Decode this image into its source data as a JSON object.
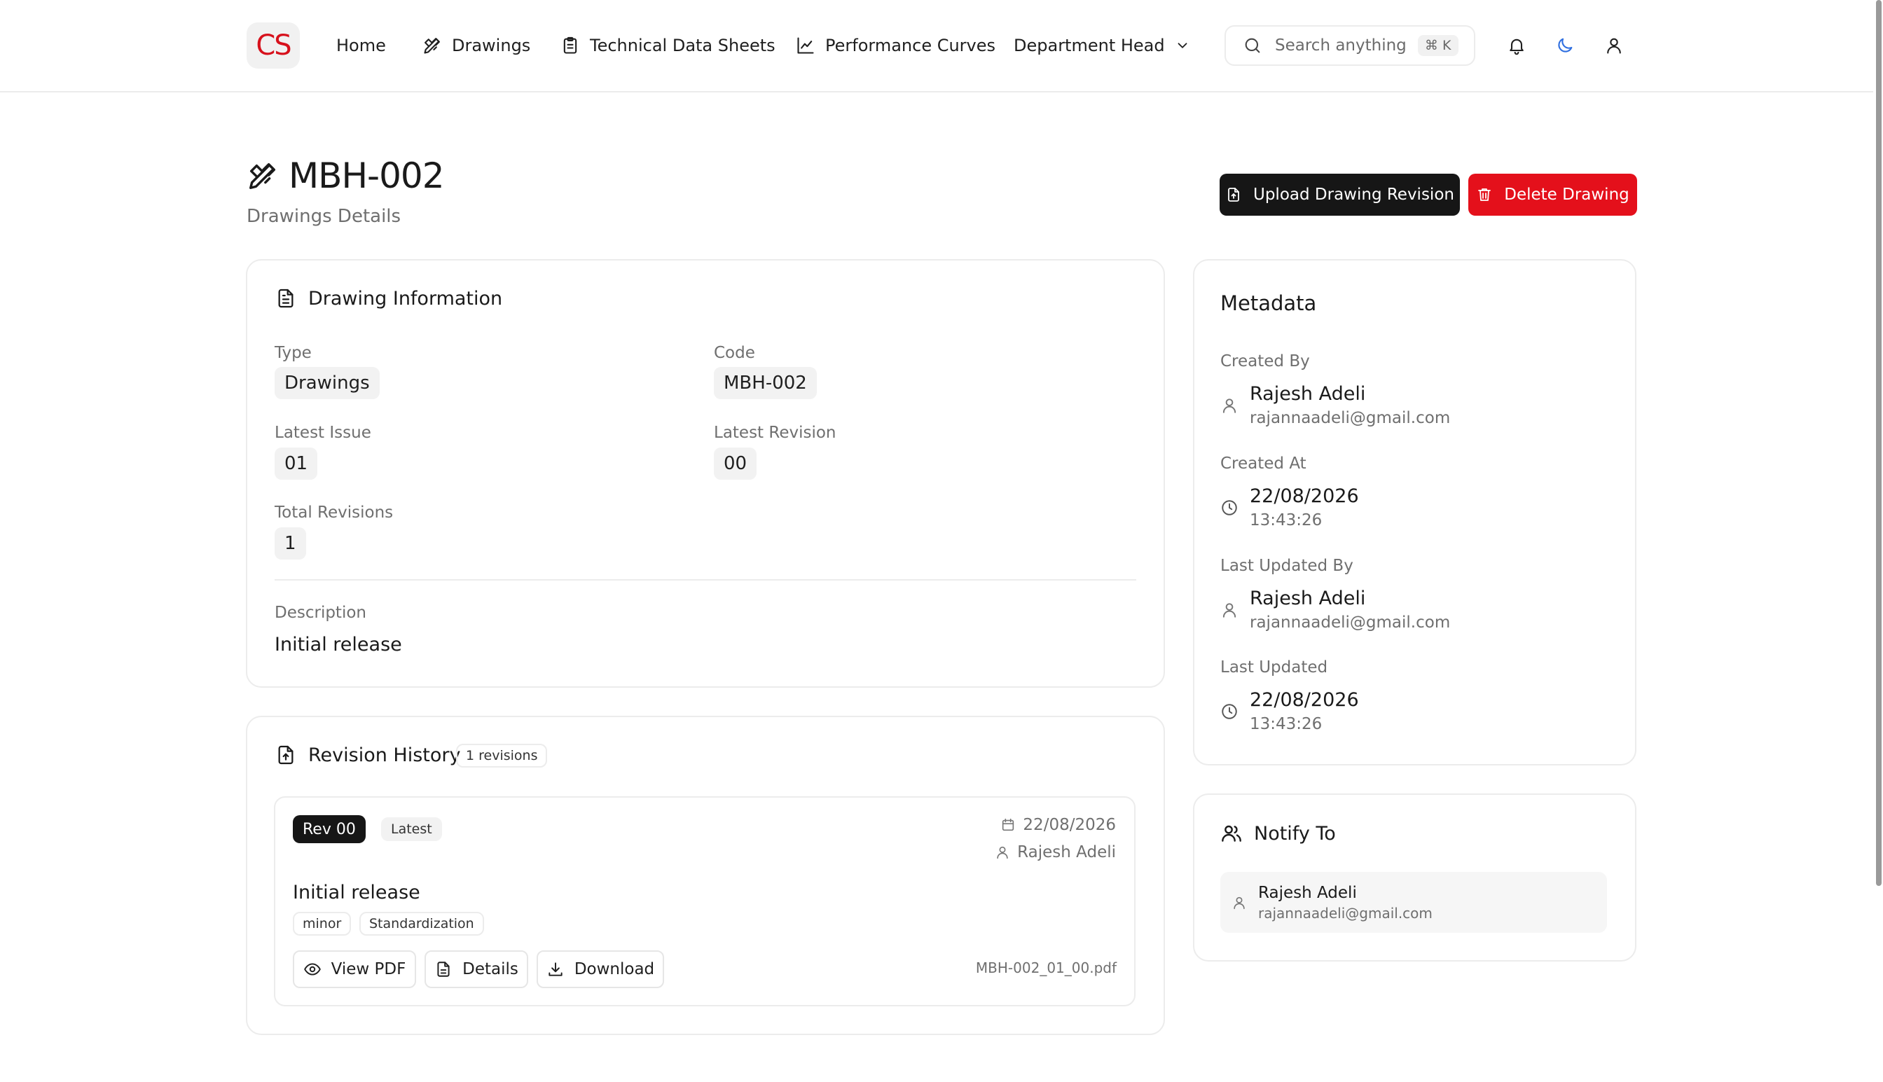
{
  "app": {
    "logo_text": "CS"
  },
  "nav": {
    "home": "Home",
    "drawings": "Drawings",
    "tds": "Technical Data Sheets",
    "curves": "Performance Curves",
    "department": "Department Head"
  },
  "search": {
    "placeholder": "Search anything...",
    "shortcut": "⌘ K"
  },
  "page": {
    "title": "MBH-002",
    "subtitle": "Drawings Details",
    "upload_label": "Upload Drawing Revision",
    "delete_label": "Delete Drawing"
  },
  "info": {
    "heading": "Drawing Information",
    "type_label": "Type",
    "type_value": "Drawings",
    "code_label": "Code",
    "code_value": "MBH-002",
    "issue_label": "Latest Issue",
    "issue_value": "01",
    "revision_label": "Latest Revision",
    "revision_value": "00",
    "total_label": "Total Revisions",
    "total_value": "1",
    "description_label": "Description",
    "description_value": "Initial release"
  },
  "metadata": {
    "heading": "Metadata",
    "created_by_label": "Created By",
    "created_by_name": "Rajesh Adeli",
    "created_by_email": "rajannaadeli@gmail.com",
    "created_at_label": "Created At",
    "created_at_date": "22/08/2026",
    "created_at_time": "13:43:26",
    "updated_by_label": "Last Updated By",
    "updated_by_name": "Rajesh Adeli",
    "updated_by_email": "rajannaadeli@gmail.com",
    "updated_label": "Last Updated",
    "updated_date": "22/08/2026",
    "updated_time": "13:43:26"
  },
  "history": {
    "heading": "Revision History",
    "count_badge": "1 revisions",
    "revision": {
      "rev_label": "Rev 00",
      "latest_label": "Latest",
      "date": "22/08/2026",
      "author": "Rajesh Adeli",
      "description": "Initial release",
      "tags": [
        "minor",
        "Standardization"
      ],
      "view_label": "View PDF",
      "details_label": "Details",
      "download_label": "Download",
      "filename": "MBH-002_01_00.pdf"
    }
  },
  "notify": {
    "heading": "Notify To",
    "name": "Rajesh Adeli",
    "email": "rajannaadeli@gmail.com"
  },
  "colors": {
    "accent_red": "#e4101b",
    "dark": "#161616",
    "logo_red": "#d7111c"
  }
}
